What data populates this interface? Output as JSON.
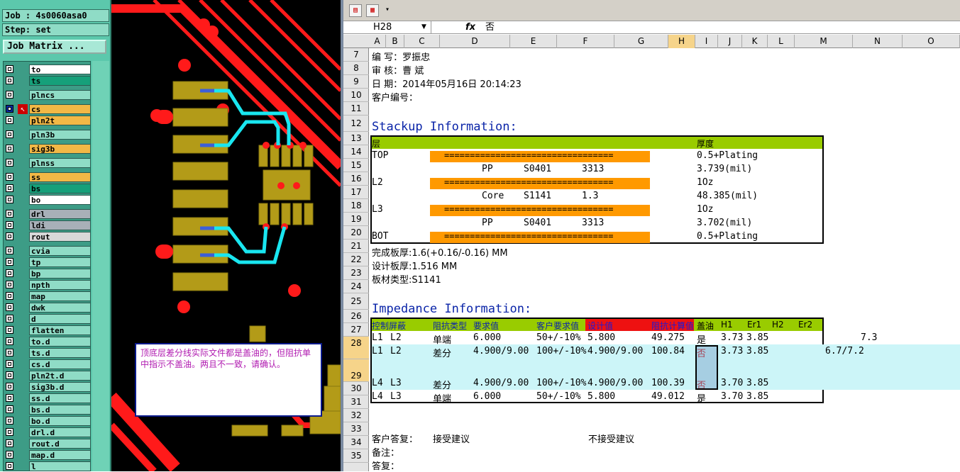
{
  "job_panel": {
    "job": "Job : 4s0060asa0",
    "step": "Step: set",
    "matrix_button": "Job Matrix ...",
    "layers": [
      {
        "name": "to",
        "color": "#ffffff",
        "checked": false
      },
      {
        "name": "ts",
        "color": "#16a07a",
        "checked": false
      },
      {
        "name": "plncs",
        "color": "#8fdcc6",
        "checked": false
      },
      {
        "name": "cs",
        "color": "#f2b846",
        "checked": true
      },
      {
        "name": "pln2t",
        "color": "#f2b846",
        "checked": false
      },
      {
        "name": "pln3b",
        "color": "#8fdcc6",
        "checked": false
      },
      {
        "name": "sig3b",
        "color": "#f2b846",
        "checked": false
      },
      {
        "name": "plnss",
        "color": "#8fdcc6",
        "checked": false
      },
      {
        "name": "ss",
        "color": "#f2b846",
        "checked": false
      },
      {
        "name": "bs",
        "color": "#16a07a",
        "checked": false
      },
      {
        "name": "bo",
        "color": "#ffffff",
        "checked": false
      },
      {
        "name": "drl",
        "color": "#a8b0b8",
        "checked": false
      },
      {
        "name": "ldi",
        "color": "#a8b0b8",
        "checked": false
      },
      {
        "name": "rout",
        "color": "#d8d8d8",
        "checked": false
      },
      {
        "name": "cvia",
        "color": "#8fdcc6",
        "checked": false
      },
      {
        "name": "tp",
        "color": "#8fdcc6",
        "checked": false
      },
      {
        "name": "bp",
        "color": "#8fdcc6",
        "checked": false
      },
      {
        "name": "npth",
        "color": "#8fdcc6",
        "checked": false
      },
      {
        "name": "map",
        "color": "#8fdcc6",
        "checked": false
      },
      {
        "name": "dwk",
        "color": "#8fdcc6",
        "checked": false
      },
      {
        "name": "d",
        "color": "#8fdcc6",
        "checked": false
      },
      {
        "name": "flatten",
        "color": "#8fdcc6",
        "checked": false
      },
      {
        "name": "to.d",
        "color": "#8fdcc6",
        "checked": false
      },
      {
        "name": "ts.d",
        "color": "#8fdcc6",
        "checked": false
      },
      {
        "name": "cs.d",
        "color": "#8fdcc6",
        "checked": false
      },
      {
        "name": "pln2t.d",
        "color": "#8fdcc6",
        "checked": false
      },
      {
        "name": "sig3b.d",
        "color": "#8fdcc6",
        "checked": false
      },
      {
        "name": "ss.d",
        "color": "#8fdcc6",
        "checked": false
      },
      {
        "name": "bs.d",
        "color": "#8fdcc6",
        "checked": false
      },
      {
        "name": "bo.d",
        "color": "#8fdcc6",
        "checked": false
      },
      {
        "name": "drl.d",
        "color": "#8fdcc6",
        "checked": false
      },
      {
        "name": "rout.d",
        "color": "#8fdcc6",
        "checked": false
      },
      {
        "name": "map.d",
        "color": "#8fdcc6",
        "checked": false
      },
      {
        "name": "l",
        "color": "#8fdcc6",
        "checked": false
      }
    ]
  },
  "pcb": {
    "callout": "顶底层差分线实际文件都是盖油的，但阻抗单中指示不盖油。两且不一致，请确认。",
    "colors": {
      "background": "#000000",
      "copper": "#ff1a1a",
      "pad": "#b39b18",
      "trace_cyan": "#19e6f0",
      "trace_blue": "#3c5fd8"
    }
  },
  "sheet": {
    "name_box": "H28",
    "fx": "fx",
    "formula": "否",
    "columns": [
      "A",
      "B",
      "C",
      "D",
      "E",
      "F",
      "G",
      "H",
      "I",
      "J",
      "K",
      "L",
      "M",
      "N",
      "O"
    ],
    "rows": [
      "7",
      "8",
      "9",
      "10",
      "11",
      "12",
      "13",
      "14",
      "15",
      "16",
      "17",
      "18",
      "19",
      "20",
      "21",
      "22",
      "23",
      "24",
      "25",
      "26",
      "27",
      "28",
      "29",
      "30",
      "31",
      "32",
      "33",
      "34",
      "35"
    ],
    "info": {
      "r7": "编    写：罗振忠",
      "r8": "审    核：曹  斌",
      "r9": "日    期：2014年05月16日 20:14:23",
      "r10": "客户编号："
    },
    "stackup": {
      "title": "Stackup Information:",
      "header_layer": "层",
      "header_thickness": "厚度",
      "copper_bar": "=================================",
      "rows": [
        {
          "layer": "TOP",
          "thickness": "0.5+Plating"
        },
        {
          "material": "PP",
          "code": "S0401",
          "spec": "3313",
          "thickness": "3.739(mil)"
        },
        {
          "layer": "L2",
          "thickness": "1Oz"
        },
        {
          "material": "Core",
          "code": "S1141",
          "spec": "1.3",
          "thickness": "48.385(mil)"
        },
        {
          "layer": "L3",
          "thickness": "1Oz"
        },
        {
          "material": "PP",
          "code": "S0401",
          "spec": "3313",
          "thickness": "3.702(mil)"
        },
        {
          "layer": "BOT",
          "thickness": "0.5+Plating"
        }
      ]
    },
    "summary": {
      "r21": "完成板厚:1.6(+0.16/-0.16) MM",
      "r22": "设计板厚:1.516 MM",
      "r23": "板材类型:S1141"
    },
    "impedance": {
      "title": "Impedance Information:",
      "headers": {
        "control": "控制",
        "shield": "屏蔽",
        "type": "阻抗类型",
        "req": "要求值",
        "cust": "客户要求值",
        "design": "设计值",
        "calc": "阻抗计算值",
        "mask": "盖油",
        "h1": "H1",
        "er1": "Er1",
        "h2": "H2",
        "er2": "Er2"
      },
      "rows": [
        {
          "a": "L1",
          "b": "L2",
          "type": "单端",
          "req": "6.000",
          "cust": "50+/-10%",
          "design": "5.800",
          "calc": "49.275",
          "mask": "是",
          "h1": "3.73",
          "er1": "3.85",
          "extra": "7.3"
        },
        {
          "a": "L1",
          "b": "L2",
          "type": "差分",
          "req": "4.900/9.000",
          "cust": "100+/-10%",
          "design": "4.900/9.000",
          "calc": "100.84",
          "mask": "否",
          "h1": "3.73",
          "er1": "3.85",
          "extra": "6.7/7.2"
        },
        {
          "a": "L4",
          "b": "L3",
          "type": "差分",
          "req": "4.900/9.000",
          "cust": "100+/-10%",
          "design": "4.900/9.000",
          "calc": "100.39",
          "mask": "否",
          "h1": "3.70",
          "er1": "3.85",
          "extra": ""
        },
        {
          "a": "L4",
          "b": "L3",
          "type": "单端",
          "req": "6.000",
          "cust": "50+/-10%",
          "design": "5.800",
          "calc": "49.012",
          "mask": "是",
          "h1": "3.70",
          "er1": "3.85",
          "extra": ""
        }
      ]
    },
    "reply": {
      "label": "客户答复：",
      "accept": "接受建议",
      "reject": "不接受建议",
      "note": "备注：",
      "answer": "答复："
    },
    "colors": {
      "header_green": "#99cc00",
      "copper_orange": "#ff9900",
      "header_red": "#ee1111",
      "highlight_cyan": "#ccf5f8",
      "text_blue": "#0a24a8"
    }
  }
}
